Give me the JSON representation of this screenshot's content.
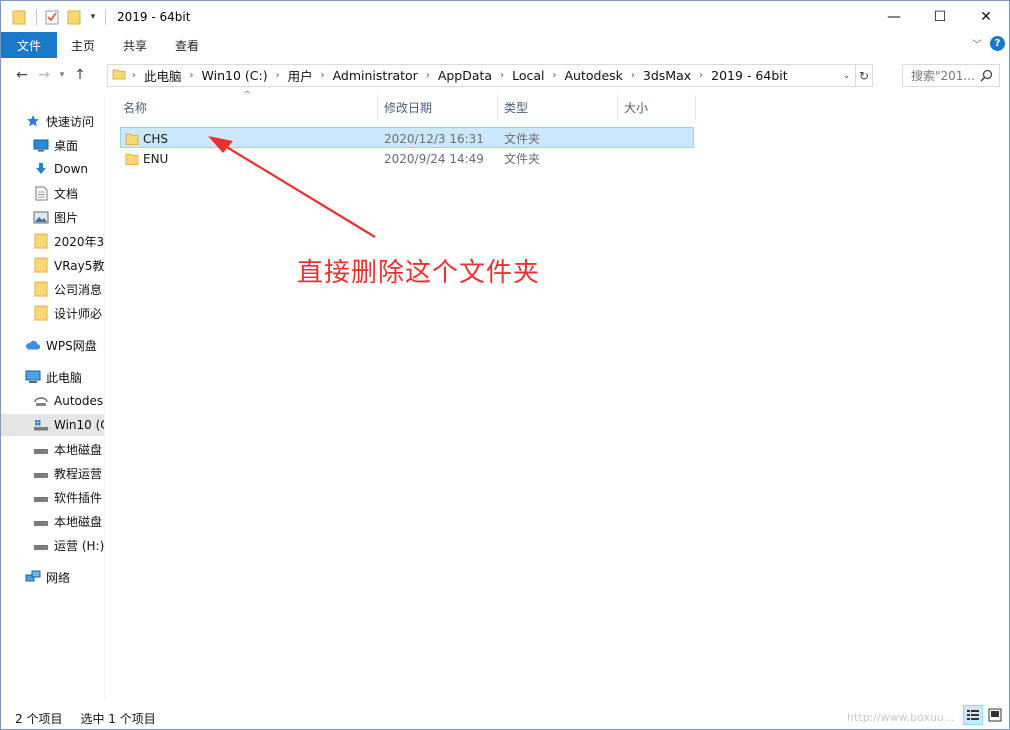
{
  "window": {
    "title": "2019 - 64bit",
    "minimize_glyph": "—",
    "maximize_glyph": "☐",
    "close_glyph": "✕"
  },
  "ribbon": {
    "tabs": [
      "文件",
      "主页",
      "共享",
      "查看"
    ],
    "help_glyph": "?"
  },
  "address": {
    "breadcrumb": [
      "此电脑",
      "Win10 (C:)",
      "用户",
      "Administrator",
      "AppData",
      "Local",
      "Autodesk",
      "3dsMax",
      "2019 - 64bit"
    ],
    "search_placeholder": "搜索\"201..."
  },
  "sidebar": {
    "items": [
      {
        "label": "快速访问",
        "icon": "star-icon"
      },
      {
        "label": "桌面",
        "icon": "desktop-icon",
        "pinned": true
      },
      {
        "label": "Down",
        "icon": "download-icon",
        "pinned": true
      },
      {
        "label": "文档",
        "icon": "document-icon",
        "pinned": true
      },
      {
        "label": "图片",
        "icon": "picture-icon",
        "pinned": true
      },
      {
        "label": "2020年3",
        "icon": "folder-icon"
      },
      {
        "label": "VRay5教",
        "icon": "folder-icon"
      },
      {
        "label": "公司消息",
        "icon": "folder-icon"
      },
      {
        "label": "设计师必",
        "icon": "folder-icon"
      },
      {
        "label": "WPS网盘",
        "icon": "cloud-icon"
      },
      {
        "label": "此电脑",
        "icon": "computer-icon"
      },
      {
        "label": "Autodes",
        "icon": "network-drive-icon"
      },
      {
        "label": "Win10 (C",
        "icon": "system-drive-icon",
        "selected": true
      },
      {
        "label": "本地磁盘",
        "icon": "drive-icon"
      },
      {
        "label": "教程运营",
        "icon": "drive-icon"
      },
      {
        "label": "软件插件",
        "icon": "drive-icon"
      },
      {
        "label": "本地磁盘",
        "icon": "drive-icon"
      },
      {
        "label": "运营 (H:)",
        "icon": "drive-icon"
      },
      {
        "label": "网络",
        "icon": "network-icon"
      }
    ]
  },
  "columns": {
    "name": "名称",
    "modified": "修改日期",
    "type": "类型",
    "size": "大小"
  },
  "files": [
    {
      "name": "CHS",
      "modified": "2020/12/3 16:31",
      "type": "文件夹",
      "size": "",
      "selected": true
    },
    {
      "name": "ENU",
      "modified": "2020/9/24 14:49",
      "type": "文件夹",
      "size": "",
      "selected": false
    }
  ],
  "annotation": {
    "text": "直接删除这个文件夹",
    "color": "#e53333"
  },
  "status": {
    "count": "2 个项目",
    "selection": "选中 1 个项目"
  },
  "watermark": "http://www.boxuu...",
  "colors": {
    "accent": "#1979ca",
    "selection_bg": "#cce8ff",
    "selection_border": "#99d1ff",
    "folder": "#f8d775"
  }
}
